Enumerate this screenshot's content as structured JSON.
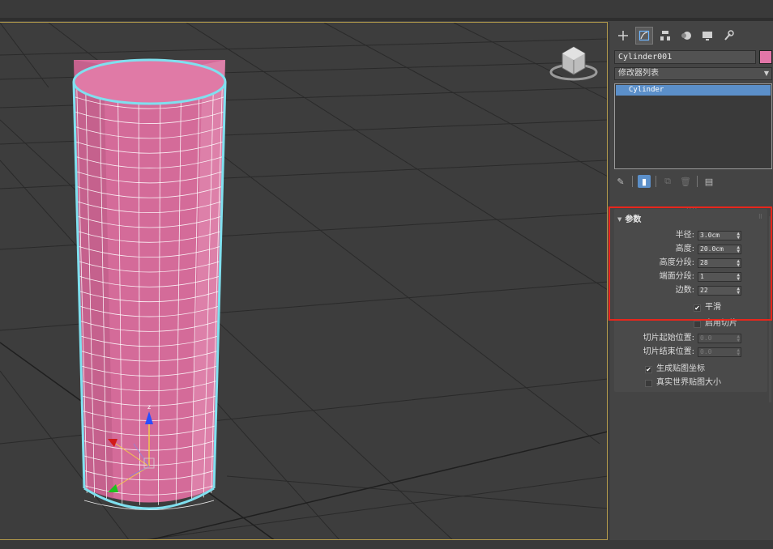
{
  "object": {
    "name": "Cylinder001",
    "color": "#e276a8"
  },
  "panel_tabs": [
    {
      "icon": "create-plus-icon",
      "active": false
    },
    {
      "icon": "modify-icon",
      "active": true
    },
    {
      "icon": "hierarchy-icon",
      "active": false
    },
    {
      "icon": "motion-icon",
      "active": false
    },
    {
      "icon": "display-icon",
      "active": false
    },
    {
      "icon": "utilities-wrench-icon",
      "active": false
    }
  ],
  "modifier_list": {
    "label": "修改器列表"
  },
  "modifier_stack": {
    "items": [
      "Cylinder"
    ]
  },
  "stack_tools": [
    {
      "icon": "pin-stack-icon",
      "state": "normal"
    },
    {
      "icon": "show-end-result-icon",
      "state": "active"
    },
    {
      "icon": "make-unique-icon",
      "state": "dim"
    },
    {
      "icon": "remove-modifier-icon",
      "state": "dim"
    },
    {
      "icon": "configure-modifier-sets-icon",
      "state": "normal"
    }
  ],
  "parameters": {
    "title": "参数",
    "radius": {
      "label": "半径:",
      "value": "3.0cm"
    },
    "height": {
      "label": "高度:",
      "value": "20.0cm"
    },
    "height_segments": {
      "label": "高度分段:",
      "value": "28"
    },
    "cap_segments": {
      "label": "端面分段:",
      "value": "1"
    },
    "sides": {
      "label": "边数:",
      "value": "22"
    },
    "smooth": {
      "label": "平滑",
      "checked": true
    },
    "slice_on": {
      "label": "启用切片",
      "checked": false
    },
    "slice_from": {
      "label": "切片起始位置:",
      "value": "0.0"
    },
    "slice_to": {
      "label": "切片结束位置:",
      "value": "0.0"
    },
    "gen_mapping": {
      "label": "生成贴图坐标",
      "checked": true
    },
    "real_world_map": {
      "label": "真实世界贴图大小",
      "checked": false
    }
  },
  "viewport": {
    "background": "#3d3d3d",
    "border_color": "#b39a4a",
    "cylinder_color": "#e07aa6",
    "selection_outline": "#7fe0ef",
    "gizmo_axis_label_z": "z"
  },
  "highlight_color": "#e8261c"
}
